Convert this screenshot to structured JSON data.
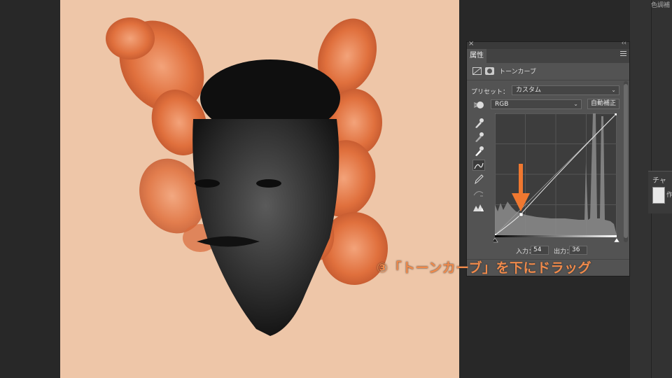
{
  "panel": {
    "tab_label": "属性",
    "adjustment_title": "トーンカーブ",
    "preset_label": "プリセット：",
    "preset_value": "カスタム",
    "channel_value": "RGB",
    "auto_button": "自動補正",
    "input_label": "入力：",
    "input_value": "54",
    "output_label": "出力：",
    "output_value": "36"
  },
  "right_dock": {
    "top_label": "色調補",
    "channels_tab": "チャン",
    "thumb_text": "作"
  },
  "annotation": {
    "text": "③「トーンカーブ」を下にドラッグ",
    "color": "#f08a4b"
  },
  "canvas": {
    "background_color": "#eec6a8"
  },
  "curve": {
    "control_point": {
      "input": 54,
      "output": 36
    }
  }
}
